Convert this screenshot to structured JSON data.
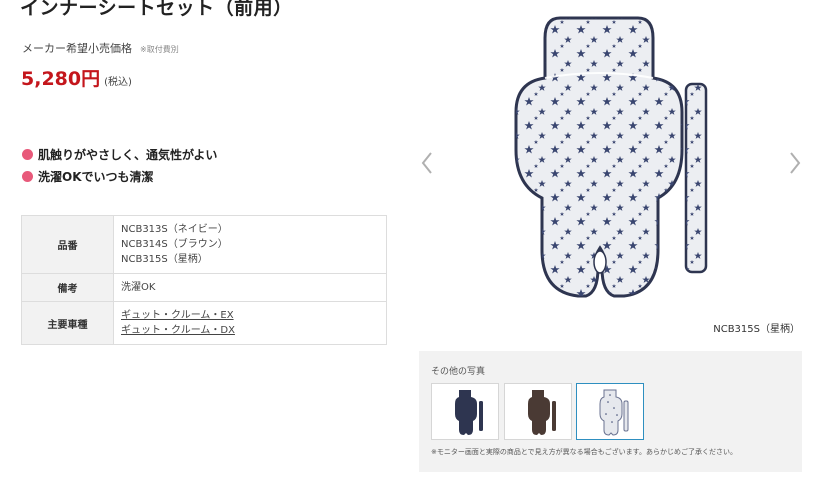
{
  "product": {
    "title": "インナーシートセット（前用）",
    "price_label": "メーカー希望小売価格",
    "price_note": "※取付費別",
    "price": "5,280円",
    "tax": "(税込)",
    "features": [
      "肌触りがやさしく、通気性がよい",
      "洗濯OKでいつも清潔"
    ]
  },
  "spec_table": {
    "rows": [
      {
        "header": "品番",
        "lines": [
          "NCB313S（ネイビー）",
          "NCB314S（ブラウン）",
          "NCB315S（星柄）"
        ]
      },
      {
        "header": "備考",
        "lines": [
          "洗濯OK"
        ]
      },
      {
        "header": "主要車種",
        "links": [
          "ギュット・クルーム・EX",
          "ギュット・クルーム・DX"
        ]
      }
    ]
  },
  "gallery": {
    "caption": "NCB315S（星柄）",
    "prev_icon": "chevron-left-icon",
    "next_icon": "chevron-right-icon",
    "other_photos_label": "その他の写真",
    "note": "※モニター画面と実際の商品とで見え方が異なる場合もございます。あらかじめご了承ください。",
    "thumbnails": [
      {
        "variant": "navy",
        "color": "#2e3550",
        "active": false
      },
      {
        "variant": "brown",
        "color": "#4a3a34",
        "active": false
      },
      {
        "variant": "stars",
        "color": "#e6e8ed",
        "active": true
      }
    ]
  },
  "colors": {
    "price": "#c4161c",
    "bullet": "#e8597a",
    "active_border": "#2e8fc0",
    "star": "#3a4670",
    "seat_fabric": "#eceef2"
  }
}
